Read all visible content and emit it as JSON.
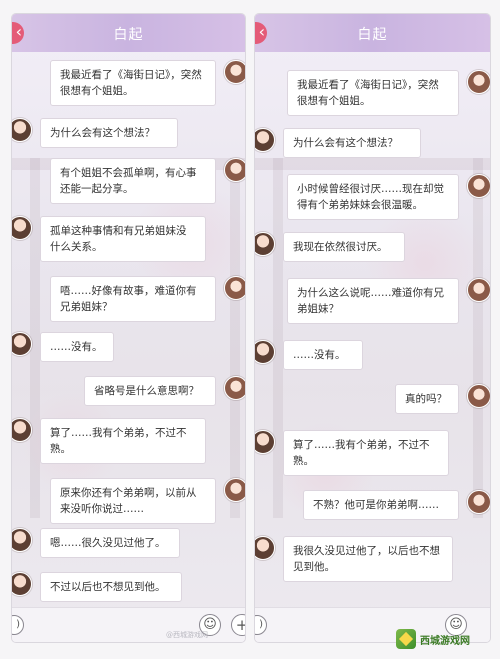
{
  "left": {
    "title": "白起",
    "messages": [
      {
        "from": "me",
        "text": "我最近看了《海街日记》，突然很想有个姐姐。"
      },
      {
        "from": "him",
        "text": "为什么会有这个想法？"
      },
      {
        "from": "me",
        "text": "有个姐姐不会孤单啊，有心事还能一起分享。"
      },
      {
        "from": "him",
        "text": "孤单这种事情和有兄弟姐妹没什么关系。"
      },
      {
        "from": "me",
        "text": "唔……好像有故事，难道你有兄弟姐妹？"
      },
      {
        "from": "him",
        "text": "……没有。"
      },
      {
        "from": "me",
        "text": "省略号是什么意思啊？"
      },
      {
        "from": "him",
        "text": "算了……我有个弟弟，不过不熟。"
      },
      {
        "from": "me",
        "text": "原来你还有个弟弟啊，以前从来没听你说过……"
      },
      {
        "from": "him",
        "text": "嗯……很久没见过他了。"
      },
      {
        "from": "him",
        "text": "不过以后也不想见到他。"
      }
    ],
    "watermark_text": "@西城游戏网"
  },
  "right": {
    "title": "白起",
    "messages": [
      {
        "from": "me",
        "text": "我最近看了《海街日记》，突然很想有个姐姐。"
      },
      {
        "from": "him",
        "text": "为什么会有这个想法？"
      },
      {
        "from": "me",
        "text": "小时候曾经很讨厌……现在却觉得有个弟弟妹妹会很温暖。"
      },
      {
        "from": "him",
        "text": "我现在依然很讨厌。"
      },
      {
        "from": "me",
        "text": "为什么这么说呢……难道你有兄弟姐妹？"
      },
      {
        "from": "him",
        "text": "……没有。"
      },
      {
        "from": "me",
        "text": "真的吗？"
      },
      {
        "from": "him",
        "text": "算了……我有个弟弟，不过不熟。"
      },
      {
        "from": "me",
        "text": "不熟？他可是你弟弟啊……"
      },
      {
        "from": "him",
        "text": "我很久没见过他了，以后也不想见到他。"
      }
    ]
  },
  "icons": {
    "back": "back-arrow-icon",
    "voice": "voice-icon",
    "emoji": "emoji-icon",
    "plus": "plus-icon"
  },
  "brand": {
    "site_name": "西城游戏网"
  },
  "colors": {
    "header": "#c9b4e0",
    "back_button": "#e45b78",
    "bubble": "#ffffff"
  }
}
